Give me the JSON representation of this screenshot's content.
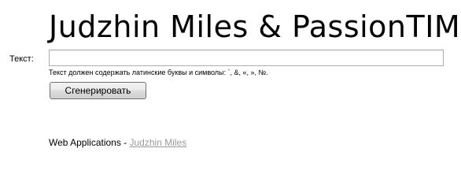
{
  "header": {
    "title": "Judzhin Miles & PassionTIME"
  },
  "form": {
    "label": "Текст:",
    "input_value": "",
    "hint": "Текст должен содержать латинские буквы и символы: `, &, «, », №.",
    "button_label": "Сгенерировать"
  },
  "footer": {
    "prefix": "Web Applications - ",
    "link_text": "Judzhin Miles"
  },
  "colors": {
    "link": "#9a9a9a",
    "input_border": "#abadb3"
  }
}
